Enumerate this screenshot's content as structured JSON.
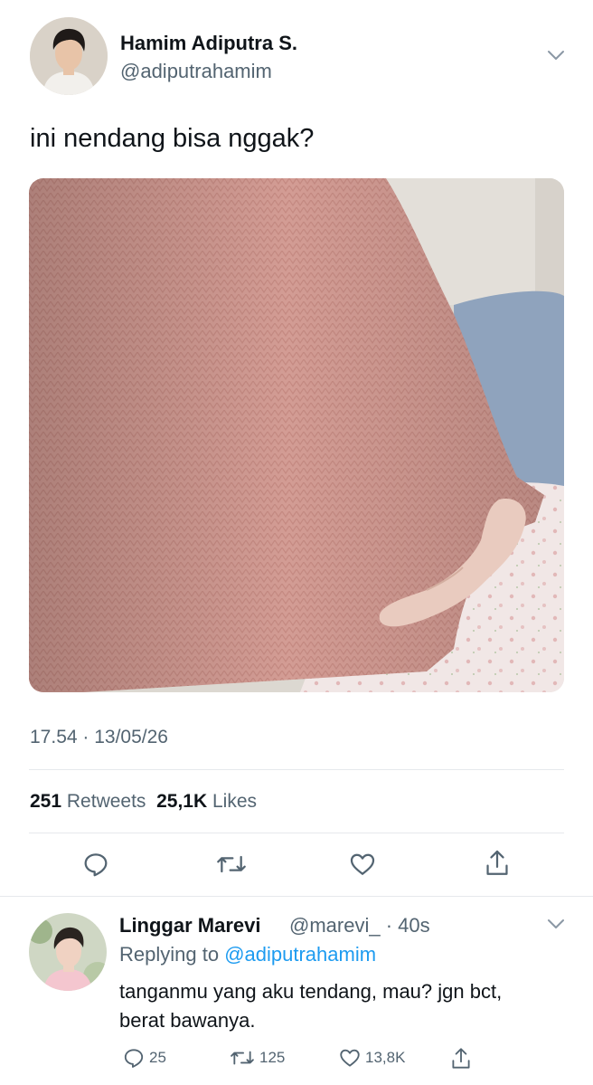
{
  "tweet": {
    "author_name": "Hamim Adiputra S.",
    "author_handle": "@adiputrahamim",
    "text": "ini nendang bisa nggak?",
    "timestamp": "17.54 · 13/05/26",
    "retweets_count": "251",
    "retweets_label": "Retweets",
    "likes_count": "25,1K",
    "likes_label": "Likes"
  },
  "reply": {
    "author_name": "Linggar Marevi",
    "author_handle": "@marevi_ · 40s",
    "replying_prefix": "Replying to",
    "replying_to": "@adiputrahamim",
    "text": "tanganmu yang aku tendang, mau? jgn bct, berat bawanya.",
    "reply_count": "25",
    "retweet_count": "125",
    "like_count": "13,8K"
  },
  "icons": {
    "more": "chevron-down-icon",
    "reply": "comment-icon",
    "retweet": "retweet-icon",
    "like": "heart-icon",
    "share": "share-icon"
  },
  "colors": {
    "text": "#0f1419",
    "secondary": "#536471",
    "link": "#1d9bf0",
    "divider": "#e6e9ec",
    "sweater": "#d49a92"
  }
}
